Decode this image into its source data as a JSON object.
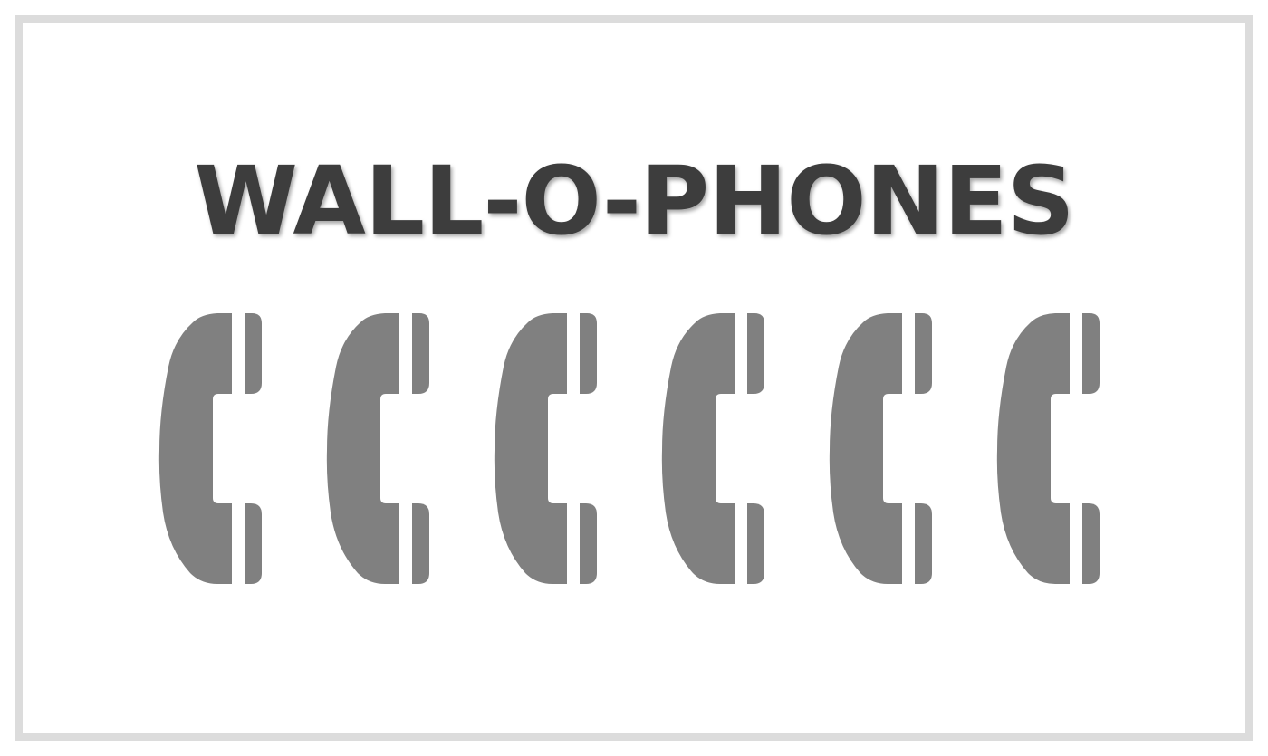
{
  "title": "WALL-O-PHONES",
  "colors": {
    "title_text": "#3d3d3d",
    "phone_fill": "#808080",
    "frame_border": "#dcdcdc",
    "background": "#ffffff"
  },
  "phones": [
    {
      "icon": "phone-handset-icon"
    },
    {
      "icon": "phone-handset-icon"
    },
    {
      "icon": "phone-handset-icon"
    },
    {
      "icon": "phone-handset-icon"
    },
    {
      "icon": "phone-handset-icon"
    },
    {
      "icon": "phone-handset-icon"
    }
  ]
}
